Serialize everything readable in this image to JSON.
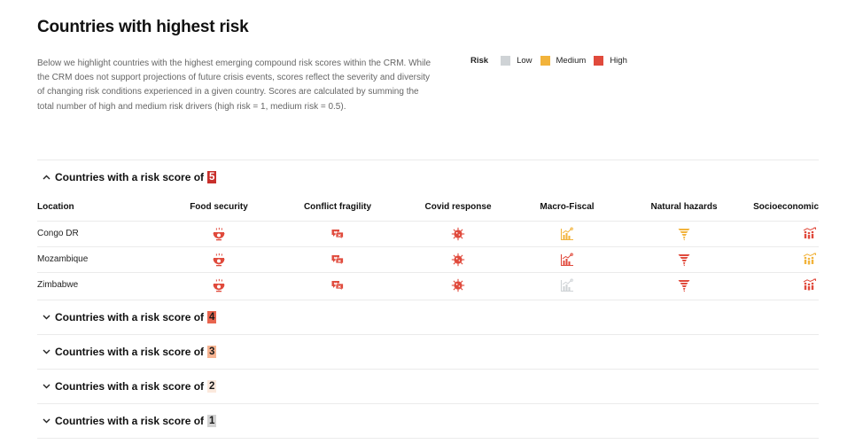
{
  "page": {
    "title": "Countries with highest risk",
    "intro": "Below we highlight countries with the highest emerging compound risk scores within the CRM. While the CRM does not support projections of future crisis events, scores reflect the severity and diversity of changing risk conditions experienced in a given country. Scores are calculated by summing the total number of high and medium risk drivers (high risk = 1, medium risk = 0.5)."
  },
  "legend": {
    "title": "Risk",
    "items": [
      {
        "label": "Low",
        "color": "#cfd3d6"
      },
      {
        "label": "Medium",
        "color": "#f2b33b"
      },
      {
        "label": "High",
        "color": "#e04a3c"
      }
    ]
  },
  "colors": {
    "low": "#cfd3d6",
    "medium": "#f2b33b",
    "high": "#e04a3c"
  },
  "sections": [
    {
      "title": "Countries with a risk score of",
      "score": "5",
      "badge_bg": "#c8302c",
      "badge_fg": "#ffffff",
      "expanded": true,
      "columns": [
        "Location",
        "Food security",
        "Conflict fragility",
        "Covid response",
        "Macro-Fiscal",
        "Natural hazards",
        "Socioeconomic"
      ],
      "rows": [
        {
          "location": "Congo DR",
          "risks": [
            "high",
            "high",
            "high",
            "medium",
            "medium",
            "high"
          ]
        },
        {
          "location": "Mozambique",
          "risks": [
            "high",
            "high",
            "high",
            "high",
            "high",
            "medium"
          ]
        },
        {
          "location": "Zimbabwe",
          "risks": [
            "high",
            "high",
            "high",
            "low",
            "high",
            "high"
          ]
        }
      ]
    },
    {
      "title": "Countries with a risk score of",
      "score": "4",
      "badge_bg": "#e8654f",
      "badge_fg": "#1a1a1a",
      "expanded": false
    },
    {
      "title": "Countries with a risk score of",
      "score": "3",
      "badge_bg": "#f6b492",
      "badge_fg": "#1a1a1a",
      "expanded": false
    },
    {
      "title": "Countries with a risk score of",
      "score": "2",
      "badge_bg": "#fbe9dd",
      "badge_fg": "#1a1a1a",
      "expanded": false
    },
    {
      "title": "Countries with a risk score of",
      "score": "1",
      "badge_bg": "#d3d3d3",
      "badge_fg": "#1a1a1a",
      "expanded": false
    }
  ],
  "icons": [
    "food-bowl-icon",
    "conflict-speech-icon",
    "covid-virus-icon",
    "macro-chart-icon",
    "tornado-icon",
    "people-trend-icon"
  ]
}
